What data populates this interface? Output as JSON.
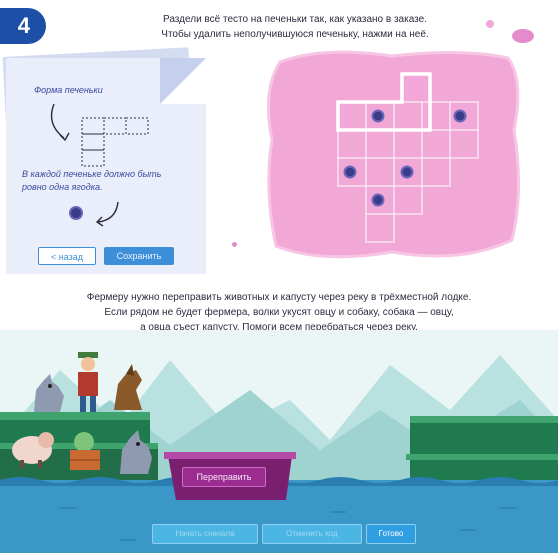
{
  "task_number": "4",
  "cookie_task": {
    "instruction_line1": "Раздели всё тесто на печеньки так, как указано в заказе.",
    "instruction_line2": "Чтобы удалить неполучившуюся печеньку, нажми на неё.",
    "shape_label": "Форма печеньки",
    "berry_hint": "В каждой печеньке должно быть ровно одна ягодка.",
    "back_button": "< назад",
    "save_button": "Сохранить"
  },
  "river_task": {
    "instruction_line1": "Фермеру нужно переправить животных и капусту через реку в трёхместной лодке.",
    "instruction_line2": "Если рядом не будет фермера, волки укусят овцу и собаку, собака — овцу,",
    "instruction_line3": "а овца съест капусту. Помоги всем перебраться через реку.",
    "ship_button": "Переправить",
    "start_over_button": "Начать сначала",
    "undo_button": "Отменить ход",
    "done_button": "Готово"
  },
  "colors": {
    "badge": "#1e4fa6",
    "dough": "#f2a8d6",
    "berry": "#3a3b8a",
    "accent": "#3d8fd9",
    "boat": "#9a2d8f",
    "water": "#3b97c8",
    "grass": "#2f8f5a"
  },
  "icons": [
    "wolf-icon",
    "farmer-icon",
    "dog-icon",
    "sheep-icon",
    "cabbage-icon",
    "boat-icon",
    "berry-icon",
    "arrow-icon"
  ]
}
